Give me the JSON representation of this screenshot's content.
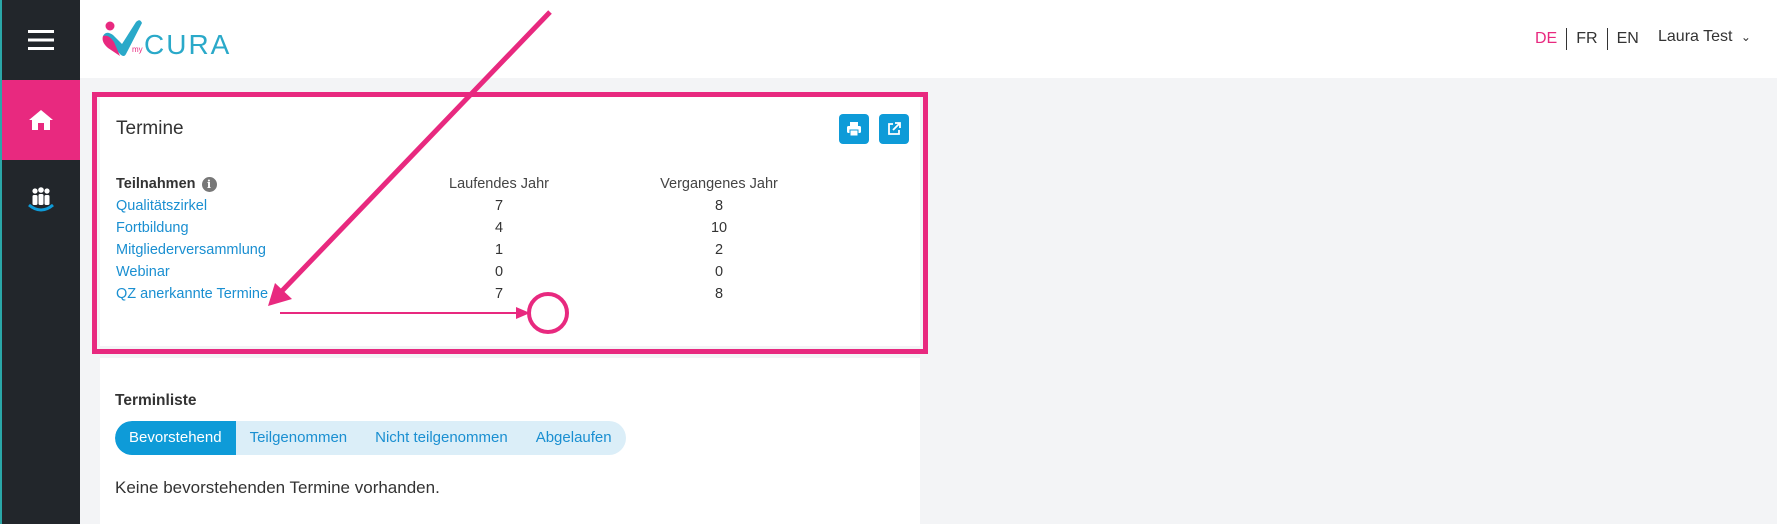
{
  "header": {
    "logo_text": "CURA",
    "logo_prefix": "my",
    "languages": [
      {
        "label": "DE",
        "active": true
      },
      {
        "label": "FR",
        "active": false
      },
      {
        "label": "EN",
        "active": false
      }
    ],
    "user_name": "Laura Test",
    "user_caret": "⌄"
  },
  "sidebar": {
    "items": [
      {
        "icon": "menu-icon"
      },
      {
        "icon": "home-icon",
        "active": true
      },
      {
        "icon": "group-icon"
      }
    ]
  },
  "termine_card": {
    "title": "Termine",
    "print_button_icon": "print-icon",
    "open_button_icon": "external-link-icon",
    "table": {
      "headers": [
        "Teilnahmen",
        "Laufendes Jahr",
        "Vergangenes Jahr"
      ],
      "info_glyph": "i",
      "rows": [
        {
          "label": "Qualitätszirkel",
          "current": "7",
          "previous": "8"
        },
        {
          "label": "Fortbildung",
          "current": "4",
          "previous": "10"
        },
        {
          "label": "Mitgliederversammlung",
          "current": "1",
          "previous": "2"
        },
        {
          "label": "Webinar",
          "current": "0",
          "previous": "0"
        },
        {
          "label": "QZ anerkannte Termine",
          "current": "7",
          "previous": "8"
        }
      ]
    }
  },
  "terminliste": {
    "title": "Terminliste",
    "tabs": [
      {
        "label": "Bevorstehend",
        "active": true
      },
      {
        "label": "Teilgenommen",
        "active": false
      },
      {
        "label": "Nicht teilgenommen",
        "active": false
      },
      {
        "label": "Abgelaufen",
        "active": false
      }
    ],
    "empty_message": "Keine bevorstehenden Termine vorhanden."
  },
  "colors": {
    "brand_pink": "#e8297f",
    "brand_blue": "#0e9bd8",
    "link_blue": "#1a8fd1",
    "sidebar_bg": "#22262b"
  }
}
